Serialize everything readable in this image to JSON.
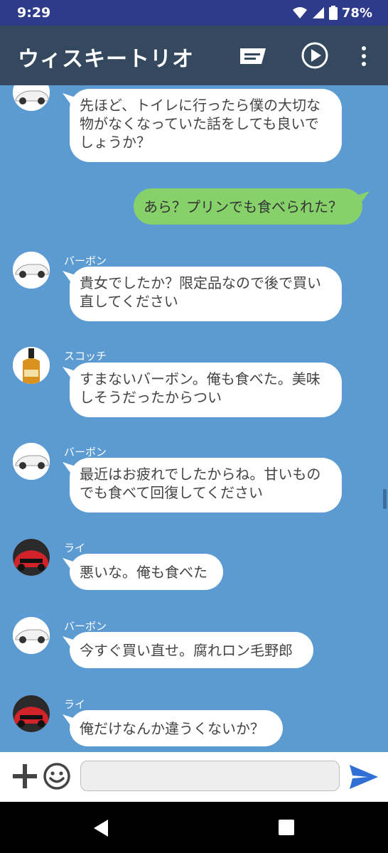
{
  "status": {
    "time": "9:29",
    "battery": "78%"
  },
  "header": {
    "title": "ウィスキートリオ"
  },
  "messages": [
    {
      "side": "left",
      "sender": "",
      "avatar": "white-car",
      "text": "先ほど、トイレに行ったら僕の大切な物がなくなっていた話をしても良いでしょうか？"
    },
    {
      "side": "right",
      "text": "あら？プリンでも食べられた？"
    },
    {
      "side": "left",
      "sender": "バーボン",
      "avatar": "white-car",
      "text": "貴女でしたか？限定品なので後で買い直してください"
    },
    {
      "side": "left",
      "sender": "スコッチ",
      "avatar": "whisky-bottle",
      "text": "すまないバーボン。俺も食べた。美味しそうだったからつい"
    },
    {
      "side": "left",
      "sender": "バーボン",
      "avatar": "white-car",
      "text": "最近はお疲れでしたからね。甘いものでも食べて回復してください"
    },
    {
      "side": "left",
      "sender": "ライ",
      "avatar": "red-car",
      "text": "悪いな。俺も食べた"
    },
    {
      "side": "left",
      "sender": "バーボン",
      "avatar": "white-car",
      "text": "今すぐ買い直せ。腐れロン毛野郎"
    },
    {
      "side": "left",
      "sender": "ライ",
      "avatar": "red-car",
      "text": "俺だけなんか違うくないか？"
    }
  ],
  "input": {
    "placeholder": ""
  },
  "colors": {
    "statusbar": "#2e3a8a",
    "appbar": "#34495e",
    "chat_bg": "#5b9bd2",
    "bubble_self": "#86d16a",
    "send": "#2f6fd6"
  }
}
